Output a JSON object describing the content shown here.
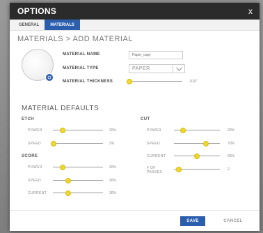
{
  "dialog": {
    "title": "OPTIONS",
    "close_glyph": "x"
  },
  "tabs": [
    {
      "label": "GENERAL",
      "active": false
    },
    {
      "label": "MATERIALS",
      "active": true
    }
  ],
  "heading": "MATERIALS > ADD MATERIAL",
  "form": {
    "name_label": "MATERIAL NAME",
    "name_value": "Paper_copy",
    "type_label": "MATERIAL TYPE",
    "type_value": "PAPER",
    "thickness_label": "MATERIAL THICKNESS",
    "thickness_value": "1/16\"",
    "thickness_fraction": 0.0
  },
  "defaults": {
    "title": "MATERIAL DEFAULTS",
    "etch": {
      "title": "ETCH",
      "rows": [
        {
          "label": "POWER",
          "value": "20%",
          "fraction": 0.2
        },
        {
          "label": "SPEED",
          "value": "2%",
          "fraction": 0.02
        }
      ]
    },
    "score": {
      "title": "SCORE",
      "rows": [
        {
          "label": "POWER",
          "value": "20%",
          "fraction": 0.2
        },
        {
          "label": "SPEED",
          "value": "30%",
          "fraction": 0.3
        },
        {
          "label": "CURRENT",
          "value": "30%",
          "fraction": 0.3
        }
      ]
    },
    "cut": {
      "title": "CUT",
      "rows": [
        {
          "label": "POWER",
          "value": "20%",
          "fraction": 0.2
        },
        {
          "label": "SPEED",
          "value": "70%",
          "fraction": 0.7
        },
        {
          "label": "CURRENT",
          "value": "50%",
          "fraction": 0.5
        },
        {
          "label": "# OF PASSES",
          "value": "2",
          "fraction": 0.1
        }
      ]
    }
  },
  "footer": {
    "save_label": "SAVE",
    "cancel_label": "CANCEL"
  },
  "colors": {
    "accent": "#2b5fad",
    "slider_knob": "#f0d72c",
    "titlebar": "#2b2b2b"
  }
}
